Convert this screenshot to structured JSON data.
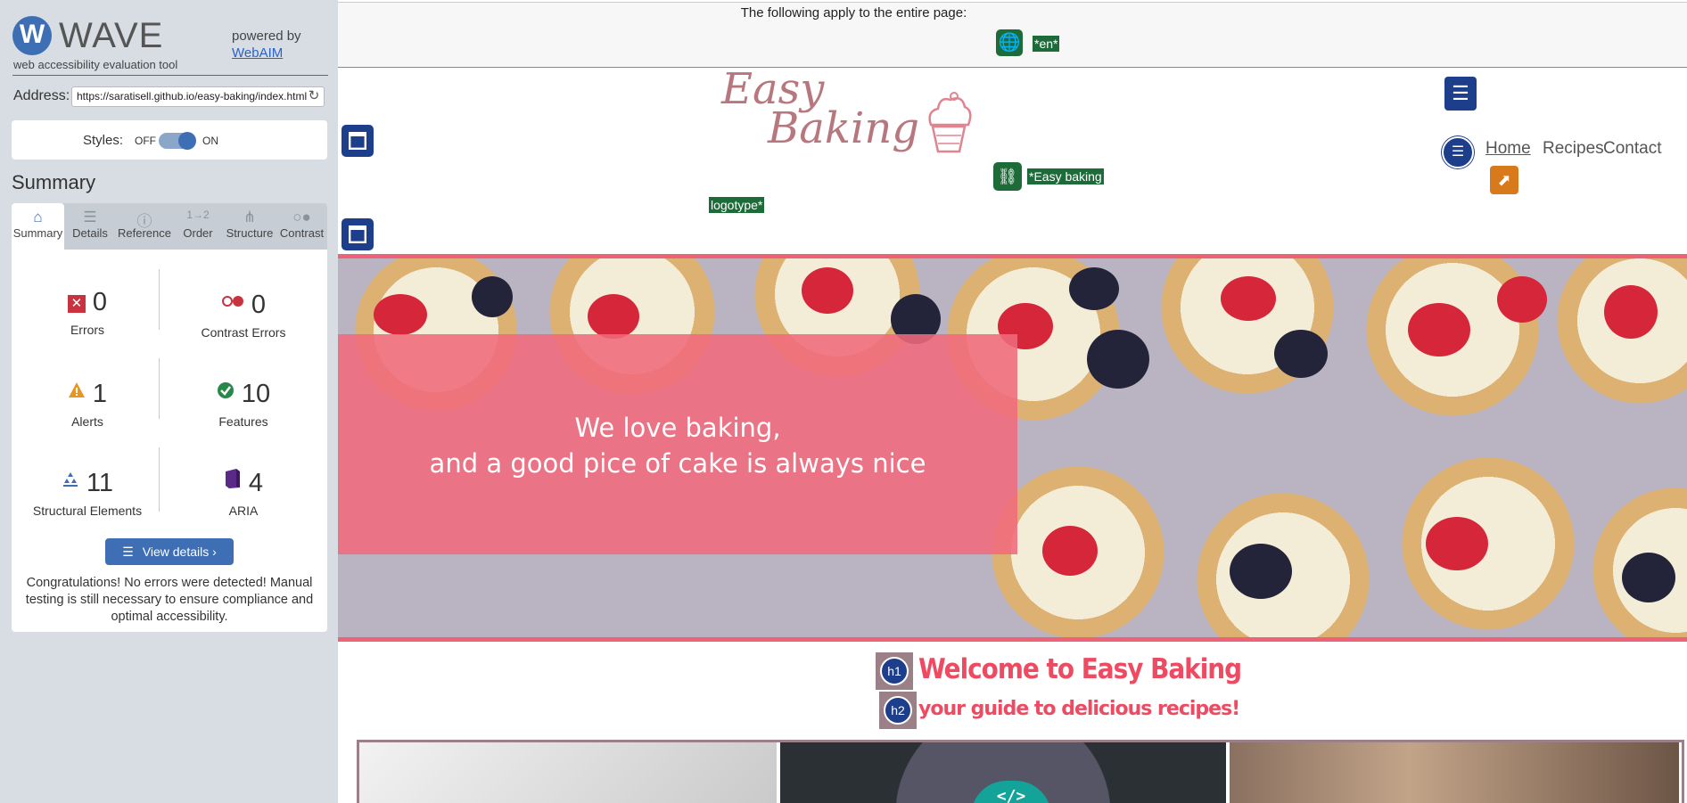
{
  "wave": {
    "logo_letter": "W",
    "logo_text": "WAVE",
    "logo_subtitle": "web accessibility evaluation tool",
    "powered_by": "powered by",
    "webaim_link": "WebAIM",
    "address_label": "Address:",
    "address_value": "https://saratisell.github.io/easy-baking/index.html",
    "styles_label": "Styles:",
    "styles_off": "OFF",
    "styles_on": "ON",
    "section_title": "Summary",
    "tabs": [
      {
        "label": "Summary",
        "icon": "home-icon"
      },
      {
        "label": "Details",
        "icon": "list-icon"
      },
      {
        "label": "Reference",
        "icon": "info-icon"
      },
      {
        "label": "Order",
        "icon": "order-icon"
      },
      {
        "label": "Structure",
        "icon": "structure-icon"
      },
      {
        "label": "Contrast",
        "icon": "contrast-icon"
      }
    ],
    "stats": {
      "errors": {
        "value": "0",
        "label": "Errors"
      },
      "contrast_errors": {
        "value": "0",
        "label": "Contrast Errors"
      },
      "alerts": {
        "value": "1",
        "label": "Alerts"
      },
      "features": {
        "value": "10",
        "label": "Features"
      },
      "structural": {
        "value": "11",
        "label": "Structural Elements"
      },
      "aria": {
        "value": "4",
        "label": "ARIA"
      }
    },
    "view_details": "View details ›",
    "congrats": "Congratulations! No errors were detected! Manual testing is still necessary to ensure compliance and optimal accessibility."
  },
  "site": {
    "apply_text": "The following apply to the entire page:",
    "lang_tag": "*en*",
    "brand_line1": "Easy",
    "brand_line2": "Baking",
    "alt_tag_1": "*Easy baking",
    "alt_tag_2": "logotype*",
    "nav": [
      "Home",
      "Recipes",
      "Contact"
    ],
    "hero_line1": "We love baking,",
    "hero_line2": "and a good pice of cake is always nice",
    "h1_badge": "h1",
    "h1_text": "Welcome to Easy Baking",
    "h2_badge": "h2",
    "h2_text": "your guide to delicious recipes!",
    "code_badge": "</>"
  },
  "colors": {
    "wave_blue": "#3e6fb4",
    "feature_green": "#1e6b3a",
    "structure_navy": "#1d3e8a",
    "accent_pink": "#ee4a62",
    "alert_orange": "#d87a1b"
  }
}
